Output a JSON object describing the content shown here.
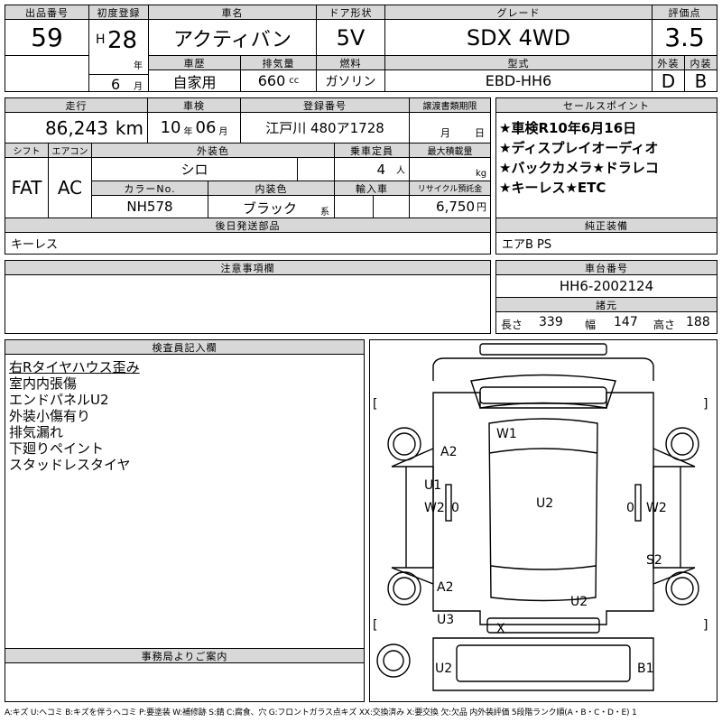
{
  "lot": {
    "label": "出品番号",
    "value": "59"
  },
  "first_reg": {
    "label": "初度登録",
    "era": "H",
    "year": "28",
    "year_unit": "年",
    "month": "6",
    "month_unit": "月"
  },
  "car_name": {
    "label": "車名",
    "value": "アクティバン"
  },
  "doors": {
    "label": "ドア形状",
    "value": "5V"
  },
  "grade": {
    "label": "グレード",
    "value": "SDX 4WD"
  },
  "score": {
    "label": "評価点",
    "value": "3.5",
    "ext_label": "外装",
    "int_label": "内装",
    "ext": "D",
    "int": "B"
  },
  "history": {
    "label": "車歴",
    "value": "自家用"
  },
  "displacement": {
    "label": "排気量",
    "value": "660",
    "unit": "cc"
  },
  "fuel": {
    "label": "燃料",
    "value": "ガソリン"
  },
  "model": {
    "label": "型式",
    "value": "EBD-HH6"
  },
  "mileage": {
    "label": "走行",
    "value": "86,243",
    "unit": "km"
  },
  "inspection": {
    "label": "車検",
    "year": "10",
    "year_unit": "年",
    "month": "06",
    "month_unit": "月"
  },
  "plate": {
    "label": "登録番号",
    "value": "江戸川 480ア1728"
  },
  "transfer": {
    "label": "譲渡書類期限",
    "month_unit": "月",
    "day_unit": "日"
  },
  "sales_points": {
    "label": "セールスポイント",
    "lines": [
      "★車検R10年6月16日",
      "★ディスプレイオーディオ",
      "★バックカメラ★ドラレコ",
      "★キーレス★ETC"
    ]
  },
  "shift": {
    "label": "シフト",
    "value": "FAT"
  },
  "aircon": {
    "label": "エアコン",
    "value": "AC"
  },
  "ext_color": {
    "label": "外装色",
    "value": "シロ"
  },
  "capacity": {
    "label": "乗車定員",
    "value": "4",
    "unit": "人"
  },
  "max_load": {
    "label": "最大積載量",
    "unit": "kg"
  },
  "color_no": {
    "label": "カラーNo.",
    "value": "NH578"
  },
  "int_color": {
    "label": "内装色",
    "value": "ブラック",
    "suffix": "系"
  },
  "import": {
    "label": "輸入車"
  },
  "recycle": {
    "label": "リサイクル預託金",
    "value": "6,750",
    "unit": "円"
  },
  "later_parts": {
    "label": "後日発送部品",
    "value": "キーレス"
  },
  "equipment": {
    "label": "純正装備",
    "value": "エアB PS"
  },
  "notes": {
    "label": "注意事項欄"
  },
  "chassis": {
    "label": "車台番号",
    "value": "HH6-2002124",
    "dim_label": "諸元",
    "length_label": "長さ",
    "length": "339",
    "width_label": "幅",
    "width": "147",
    "height_label": "高さ",
    "height": "188"
  },
  "inspector": {
    "label": "検査員記入欄",
    "lines": [
      "右Rタイヤハウス歪み",
      "室内内張傷",
      "エンドパネルU2",
      "外装小傷有り",
      "排気漏れ",
      "下廻りペイント",
      "スタッドレスタイヤ"
    ]
  },
  "office": {
    "label": "事務局よりご案内"
  },
  "diagram": {
    "brackets": [
      "[",
      "]",
      "[",
      "]"
    ],
    "marks": {
      "w1": "W1",
      "a2_upper": "A2",
      "u1": "U1",
      "w2_left": "W2",
      "w2_right": "W2",
      "u2_center": "U2",
      "s2": "S2",
      "a2_lower": "A2",
      "u2_lower_right": "U2",
      "u3": "U3",
      "x": "X",
      "u2_bottom": "U2",
      "b1": "B1",
      "zero": "0"
    }
  },
  "legend": "A:キズ U:ヘコミ B:キズを伴うヘコミ P:要塗装 W:補修跡 S:錆 C:腐食、穴 G:フロントガラス点キズ XX:交換済み X:要交換 欠:欠品 内外装評価 5段階ランク順(A・B・C・D・E) 1"
}
